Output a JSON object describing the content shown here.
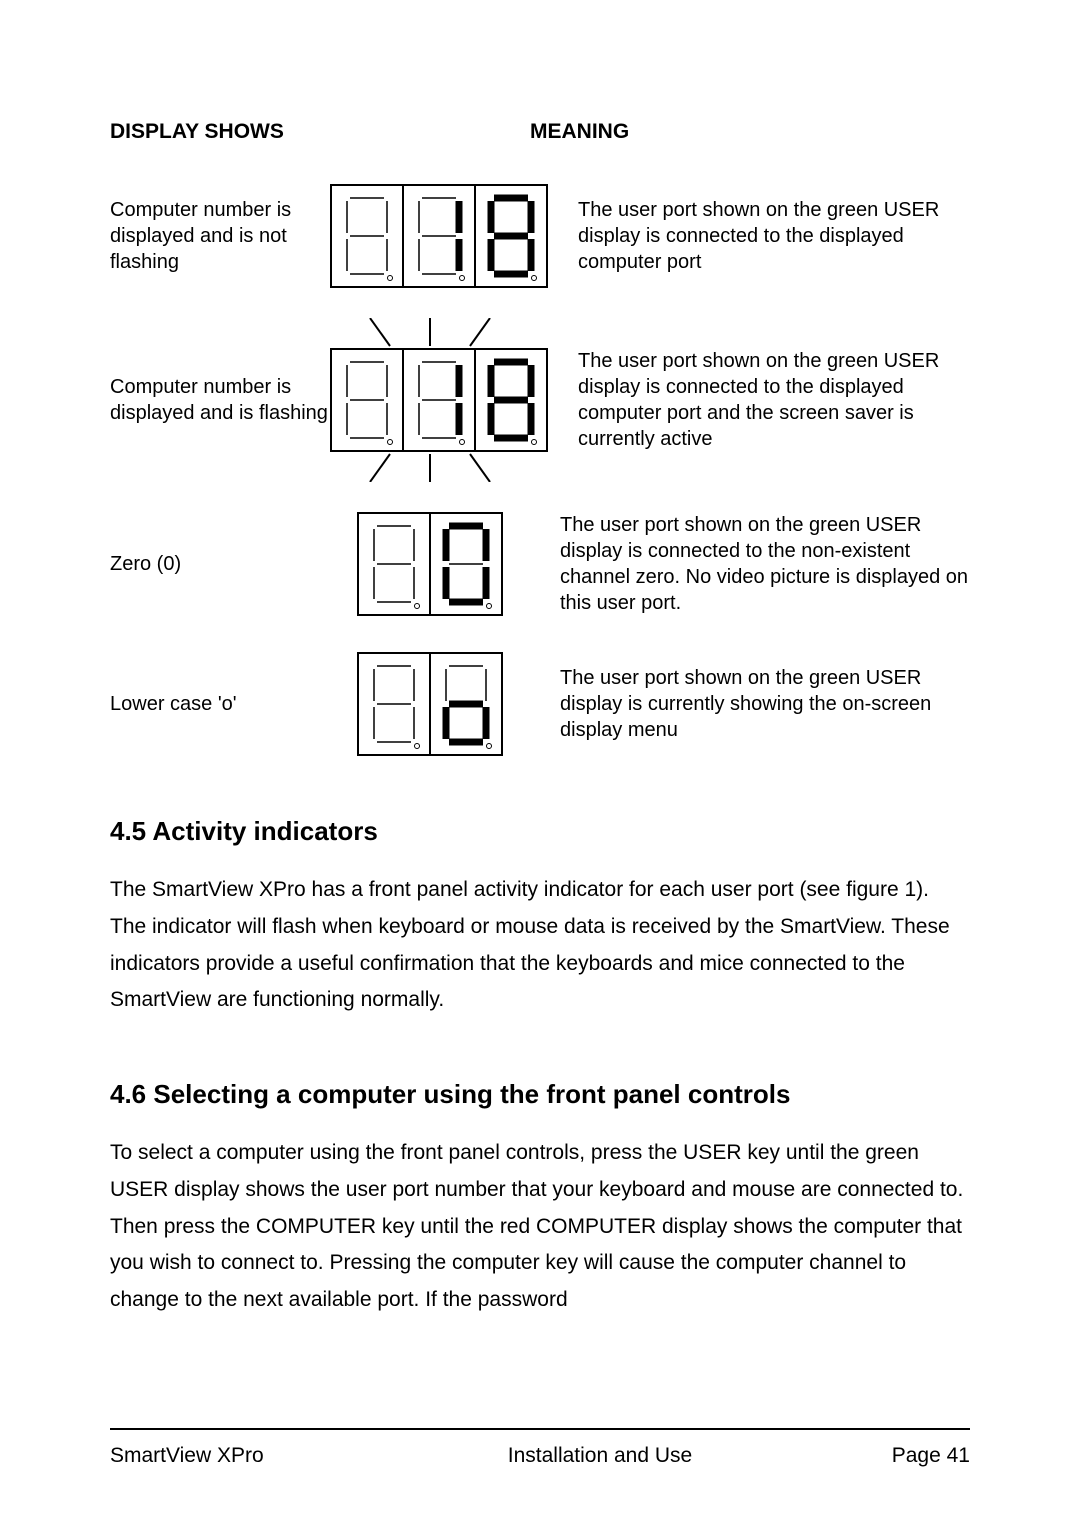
{
  "header": {
    "left": "DISPLAY SHOWS",
    "right": "MEANING"
  },
  "rows": [
    {
      "left": "Computer number is displayed and is not flashing",
      "right": "The user port shown on the green USER display is connected to the displayed computer port"
    },
    {
      "left": "Computer number is displayed and is flashing",
      "right": "The user port shown on the green USER display is connected to the displayed computer port and the screen saver is currently active"
    },
    {
      "left": "Zero (0)",
      "right": "The user port shown on the green USER display is connected to the non-existent channel zero. No video picture is displayed on this user port."
    },
    {
      "left": "Lower case 'o'",
      "right": "The user port shown on the green USER display is currently showing the on-screen display menu"
    }
  ],
  "sections": {
    "s45_title": "4.5 Activity indicators",
    "s45_body": "The SmartView XPro has a front panel activity indicator for each user port (see figure 1). The indicator will flash when keyboard or mouse data is received by the SmartView. These indicators provide a useful confirmation that the keyboards and mice connected to the SmartView are functioning normally.",
    "s46_title": "4.6 Selecting a computer using the front panel controls",
    "s46_body": "To select a computer using the front panel controls, press the USER key until the green USER display shows the user port number that your keyboard and mouse are connected to. Then press the COMPUTER key until the red COMPUTER display shows the computer that you wish to connect to. Pressing the computer key will cause the computer channel to change to the next available port. If the password"
  },
  "footer": {
    "left": "SmartView XPro",
    "center": "Installation and Use",
    "right": "Page 41"
  }
}
